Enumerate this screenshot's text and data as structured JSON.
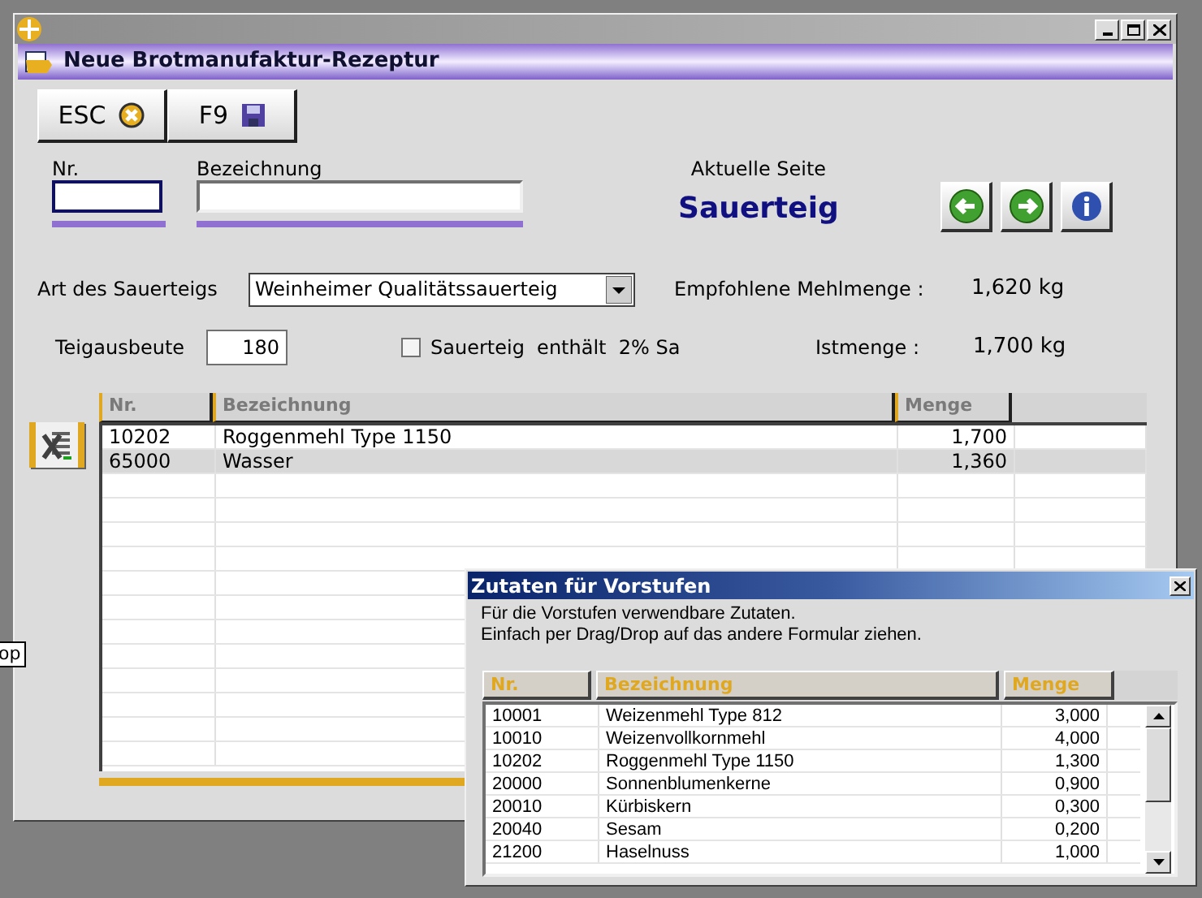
{
  "window": {
    "title": "Neue Brotmanufaktur-Rezeptur"
  },
  "toolbar": [
    {
      "label": "ESC",
      "kind": "cancel"
    },
    {
      "label": "F9",
      "kind": "save"
    }
  ],
  "fields": {
    "nr": {
      "label": "Nr."
    },
    "bezeichnung": {
      "label": "Bezeichnung"
    }
  },
  "page": {
    "label": "Aktuelle Seite",
    "name": "Sauerteig"
  },
  "nav_buttons": [
    {
      "kind": "back"
    },
    {
      "kind": "forward"
    },
    {
      "kind": "info"
    }
  ],
  "sourdough_type": {
    "label": "Art des Sauerteigs",
    "value": "Weinheimer Qualitätssauerteig"
  },
  "recommended": {
    "label": "Empfohlene Mehlmenge :",
    "value": "1,620 kg"
  },
  "yield": {
    "label": "Teigausbeute",
    "value": "180"
  },
  "contains": {
    "checked": false,
    "label": "Sauerteig  enthält  2% Sa"
  },
  "actual": {
    "label": "Istmenge :",
    "value": "1,700 kg"
  },
  "table": {
    "columns": [
      "Nr.",
      "Bezeichnung",
      "Menge"
    ],
    "rows": [
      {
        "cells": [
          "10202",
          "Roggenmehl Type 1150",
          "1,700"
        ],
        "selected": false
      },
      {
        "cells": [
          "65000",
          "Wasser",
          "1,360"
        ],
        "selected": true
      }
    ]
  },
  "tooltip": "op",
  "dialog": {
    "title": "Zutaten für Vorstufen",
    "lines": [
      "Für die Vorstufen verwendbare Zutaten.",
      "Einfach per Drag/Drop auf das andere Formular ziehen."
    ],
    "columns": [
      "Nr.",
      "Bezeichnung",
      "Menge"
    ],
    "rows": [
      [
        "10001",
        "Weizenmehl Type 812",
        "3,000"
      ],
      [
        "10010",
        "Weizenvollkornmehl",
        "4,000"
      ],
      [
        "10202",
        "Roggenmehl Type 1150",
        "1,300"
      ],
      [
        "20000",
        "Sonnenblumenkerne",
        "0,900"
      ],
      [
        "20010",
        "Kürbiskern",
        "0,300"
      ],
      [
        "20040",
        "Sesam",
        "0,200"
      ],
      [
        "21200",
        "Haselnuss",
        "1,000"
      ]
    ]
  }
}
